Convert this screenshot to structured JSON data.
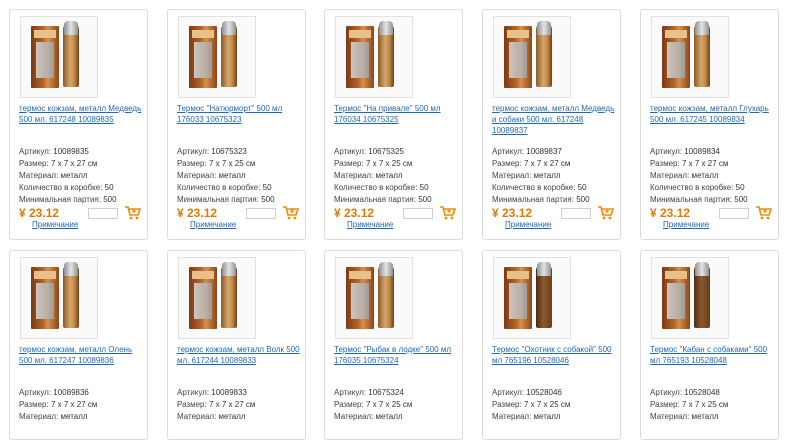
{
  "labels": {
    "article": "Артикул:",
    "size": "Размер:",
    "material": "Материал:",
    "box_qty": "Количество в коробке:",
    "min_batch": "Минимальная партия:",
    "note": "Примечание"
  },
  "products": [
    {
      "title": "термос кожзам, металл Медведь 500 мл. 617248 10089835",
      "article": "10089835",
      "size": "7 x 7 x 27 см",
      "material": "металл",
      "box_qty": "50",
      "min_batch": "500",
      "price": "¥ 23.12",
      "flask": "light"
    },
    {
      "title": "Термос \"Натюрморт\" 500 мл 176033 10675323",
      "article": "10675323",
      "size": "7 x 7 x 25 см",
      "material": "металл",
      "box_qty": "50",
      "min_batch": "500",
      "price": "¥ 23.12",
      "flask": "light"
    },
    {
      "title": "Термос \"На привале\" 500 мл 176034 10675325",
      "article": "10675325",
      "size": "7 x 7 x 25 см",
      "material": "металл",
      "box_qty": "50",
      "min_batch": "500",
      "price": "¥ 23.12",
      "flask": "light"
    },
    {
      "title": "термос кожзам, металл Медведь и собаки 500 мл. 617248 10089837",
      "article": "10089837",
      "size": "7 x 7 x 27 см",
      "material": "металл",
      "box_qty": "50",
      "min_batch": "500",
      "price": "¥ 23.12",
      "flask": "light"
    },
    {
      "title": "термос кожзам, металл Глухарь 500 мл. 617245 10089834",
      "article": "10089834",
      "size": "7 x 7 x 27 см",
      "material": "металл",
      "box_qty": "50",
      "min_batch": "500",
      "price": "¥ 23.12",
      "flask": "light"
    },
    {
      "title": "термос кожзам, металл Олень 500 мл. 617247 10089836",
      "article": "10089836",
      "size": "7 x 7 x 27 см",
      "material": "металл",
      "flask": "light"
    },
    {
      "title": "термос кожзам, металл Волк 500 мл. 617244 10089833",
      "article": "10089833",
      "size": "7 x 7 x 27 см",
      "material": "металл",
      "flask": "light"
    },
    {
      "title": "Термос \"Рыбак в лодке\" 500 мл 176035 10675324",
      "article": "10675324",
      "size": "7 x 7 x 25 см",
      "material": "металл",
      "flask": "light"
    },
    {
      "title": "Термос \"Охотник с собакой\" 500 мл 765196 10528046",
      "article": "10528046",
      "size": "7 x 7 x 25 см",
      "material": "металл",
      "flask": "dark"
    },
    {
      "title": "Термос \"Кабан с собаками\" 500 мл 765193 10528048",
      "article": "10528048",
      "size": "7 x 7 x 25 см",
      "material": "металл",
      "flask": "dark"
    }
  ],
  "colors": {
    "link": "#1f68b5",
    "price": "#e17b00",
    "cart": "#f08c00",
    "border": "#dcdcdc"
  }
}
